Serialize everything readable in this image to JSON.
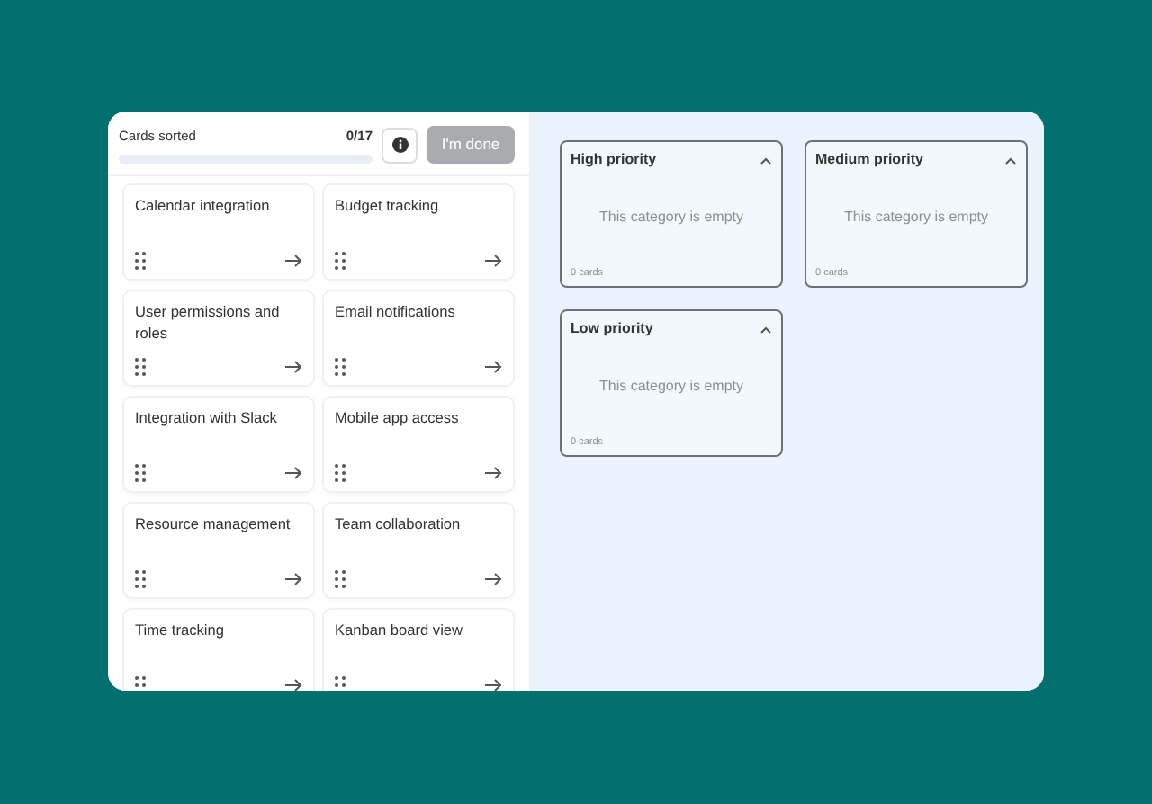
{
  "progress": {
    "label": "Cards sorted",
    "count": "0/17",
    "level": 0
  },
  "done_button": {
    "label": "I'm done",
    "disabled": true
  },
  "cards": [
    {
      "title": "Calendar integration"
    },
    {
      "title": "Budget tracking"
    },
    {
      "title": "User permissions and roles"
    },
    {
      "title": "Email notifications"
    },
    {
      "title": "Integration with Slack"
    },
    {
      "title": "Mobile app access"
    },
    {
      "title": "Resource management"
    },
    {
      "title": "Team collaboration"
    },
    {
      "title": "Time tracking"
    },
    {
      "title": "Kanban board view"
    }
  ],
  "categories": [
    {
      "title": "High priority",
      "expanded": true,
      "empty_text": "This category is empty",
      "count": "0 cards"
    },
    {
      "title": "Medium priority",
      "expanded": true,
      "empty_text": "This category is empty",
      "count": "0 cards"
    },
    {
      "title": "Low priority",
      "expanded": true,
      "empty_text": "This category is empty",
      "count": "0 cards"
    }
  ]
}
